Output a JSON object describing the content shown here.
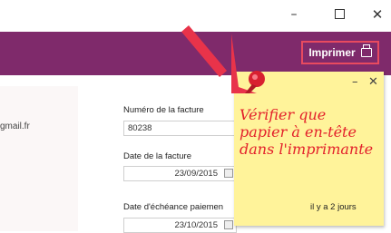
{
  "window": {
    "minimize_label": "–",
    "close_label": "✕"
  },
  "toolbar": {
    "print_label": "Imprimer"
  },
  "contact": {
    "email_fragment": "gmail.fr"
  },
  "invoice": {
    "number_label": "Numéro de la facture",
    "number_value": "80238",
    "date_label": "Date de la facture",
    "date_value": "23/09/2015",
    "due_label": "Date d'échéance paiemen",
    "due_value": "23/10/2015"
  },
  "sticky_note": {
    "text": "Vérifier que papier à en-tête dans l'imprimante",
    "minimize_label": "–",
    "close_label": "✕",
    "timestamp": "il y a 2 jours"
  },
  "colors": {
    "appbar": "#7f2a6b",
    "note_background": "#fff39a",
    "note_text": "#e3202b",
    "accent_red": "#e84a5f"
  }
}
